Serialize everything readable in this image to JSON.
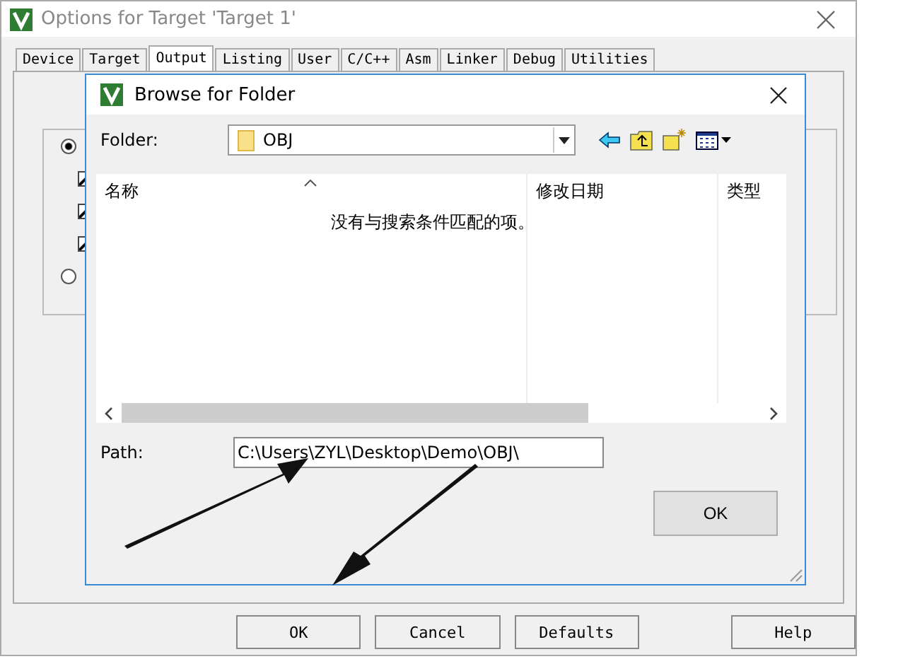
{
  "window": {
    "title": "Options for Target 'Target 1'"
  },
  "tabs": [
    {
      "label": "Device",
      "selected": false
    },
    {
      "label": "Target",
      "selected": false
    },
    {
      "label": "Output",
      "selected": true
    },
    {
      "label": "Listing",
      "selected": false
    },
    {
      "label": "User",
      "selected": false
    },
    {
      "label": "C/C++",
      "selected": false
    },
    {
      "label": "Asm",
      "selected": false
    },
    {
      "label": "Linker",
      "selected": false
    },
    {
      "label": "Debug",
      "selected": false
    },
    {
      "label": "Utilities",
      "selected": false
    }
  ],
  "options": {
    "radios": [
      {
        "selected": true
      },
      {
        "selected": false
      }
    ],
    "checkboxes": [
      {
        "checked": true
      },
      {
        "checked": true
      },
      {
        "checked": true
      }
    ]
  },
  "dialog": {
    "title": "Browse for Folder",
    "folder_label": "Folder:",
    "folder_value": "OBJ",
    "columns": [
      "名称",
      "修改日期",
      "类型"
    ],
    "empty_message": "没有与搜索条件匹配的项。",
    "path_label": "Path:",
    "path_value": "C:\\Users\\ZYL\\Desktop\\Demo\\OBJ\\",
    "ok": "OK"
  },
  "buttons": [
    "OK",
    "Cancel",
    "Defaults",
    "Help"
  ]
}
